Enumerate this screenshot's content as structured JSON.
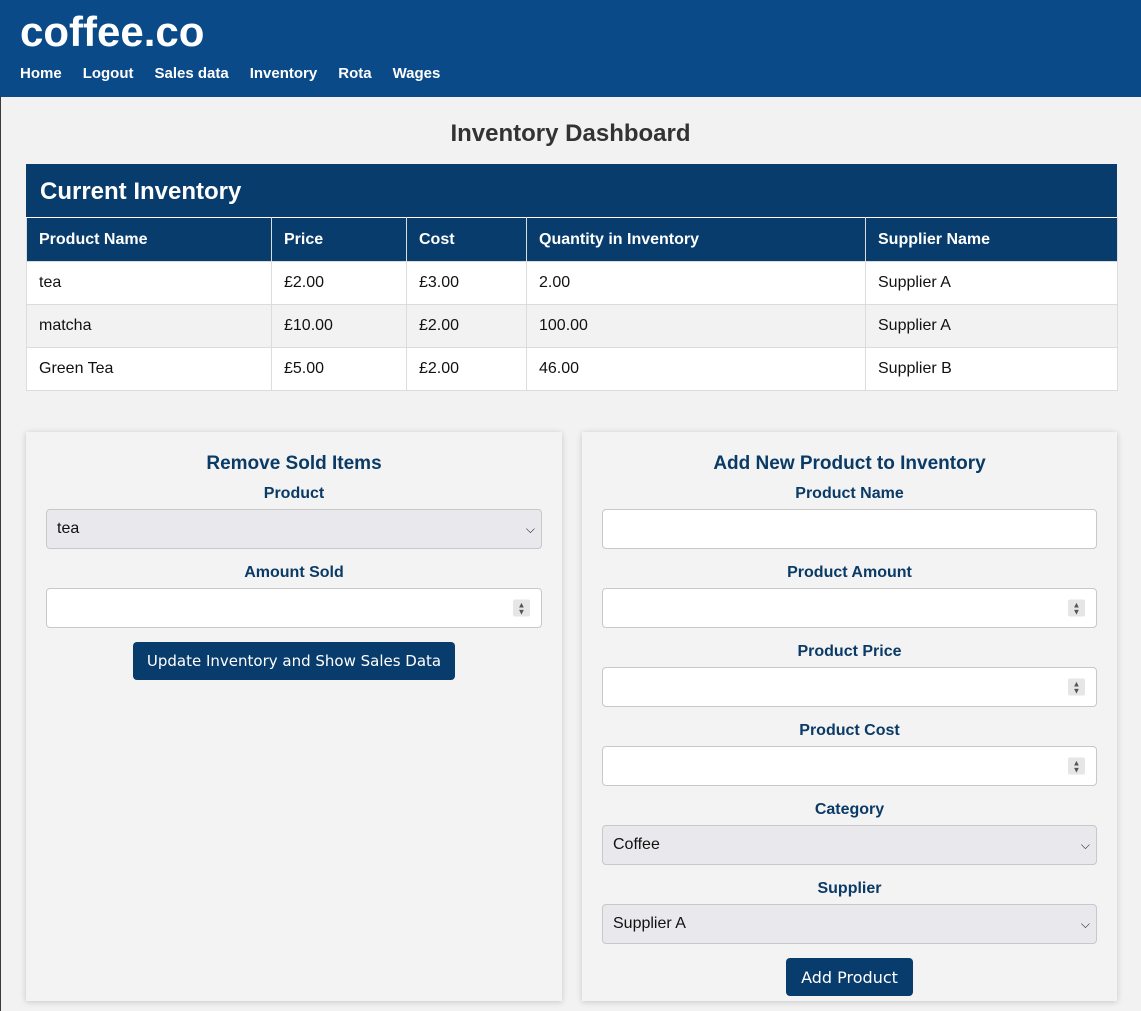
{
  "header": {
    "brand": "coffee.co",
    "nav": [
      "Home",
      "Logout",
      "Sales data",
      "Inventory",
      "Rota",
      "Wages"
    ]
  },
  "page": {
    "title": "Inventory Dashboard"
  },
  "inventory": {
    "caption": "Current Inventory",
    "columns": [
      "Product Name",
      "Price",
      "Cost",
      "Quantity in Inventory",
      "Supplier Name"
    ],
    "rows": [
      [
        "tea",
        "£2.00",
        "£3.00",
        "2.00",
        "Supplier A"
      ],
      [
        "matcha",
        "£10.00",
        "£2.00",
        "100.00",
        "Supplier A"
      ],
      [
        "Green Tea",
        "£5.00",
        "£2.00",
        "46.00",
        "Supplier B"
      ]
    ]
  },
  "remove_form": {
    "title": "Remove Sold Items",
    "product_label": "Product",
    "product_value": "tea",
    "amount_label": "Amount Sold",
    "amount_value": "",
    "submit_label": "Update Inventory and Show Sales Data"
  },
  "add_form": {
    "title": "Add New Product to Inventory",
    "name_label": "Product Name",
    "name_value": "",
    "amount_label": "Product Amount",
    "amount_value": "",
    "price_label": "Product Price",
    "price_value": "",
    "cost_label": "Product Cost",
    "cost_value": "",
    "category_label": "Category",
    "category_value": "Coffee",
    "supplier_label": "Supplier",
    "supplier_value": "Supplier A",
    "submit_label": "Add Product"
  },
  "colors": {
    "header_bg": "#0b4a88",
    "table_header_bg": "#083c6c",
    "accent_text": "#0a3a66",
    "button_bg": "#083c6c"
  }
}
